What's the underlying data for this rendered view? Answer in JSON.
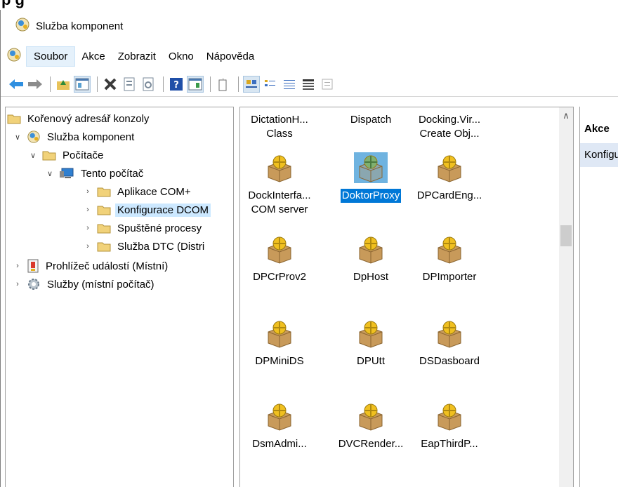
{
  "heading": "p         g",
  "window": {
    "title": "Služba komponent"
  },
  "menu": [
    "Soubor",
    "Akce",
    "Zobrazit",
    "Okno",
    "Nápověda"
  ],
  "tree": [
    {
      "label": "Kořenový adresář konzoly",
      "chevron": "",
      "icon": "folder"
    },
    {
      "label": "Služba komponent",
      "chevron": "down",
      "icon": "component"
    },
    {
      "label": "Počítače",
      "chevron": "down",
      "icon": "folder"
    },
    {
      "label": "Tento počítač",
      "chevron": "down",
      "icon": "computer"
    },
    {
      "label": "Aplikace COM+",
      "chevron": "right",
      "icon": "folder"
    },
    {
      "label": "Konfigurace DCOM",
      "chevron": "right",
      "icon": "folder",
      "selected": true
    },
    {
      "label": "Spuštěné procesy",
      "chevron": "right",
      "icon": "folder"
    },
    {
      "label": "Služba DTC (Distri",
      "chevron": "right",
      "icon": "folder"
    },
    {
      "label": "Prohlížeč událostí (Místní)",
      "chevron": "right",
      "icon": "event"
    },
    {
      "label": "Služby (místní počítač)",
      "chevron": "right",
      "icon": "gear"
    }
  ],
  "list": {
    "row0": [
      {
        "line1": "DictationH...",
        "line2": "Class"
      },
      {
        "line1": "Dispatch",
        "line2": ""
      },
      {
        "line1": "Docking.Vir...",
        "line2": "Create Obj..."
      }
    ],
    "items": [
      {
        "line1": "DockInterfa...",
        "line2": "COM server"
      },
      {
        "line1": "DoktorProxy",
        "line2": "",
        "selected": true
      },
      {
        "line1": "DPCardEng...",
        "line2": ""
      },
      {
        "line1": "DPCrProv2",
        "line2": ""
      },
      {
        "line1": "DpHost",
        "line2": ""
      },
      {
        "line1": "DPImporter",
        "line2": ""
      },
      {
        "line1": "DPMiniDS",
        "line2": ""
      },
      {
        "line1": "DPUtt",
        "line2": ""
      },
      {
        "line1": "DSDasboard",
        "line2": ""
      },
      {
        "line1": "DsmAdmi...",
        "line2": ""
      },
      {
        "line1": "DVCRender...",
        "line2": ""
      },
      {
        "line1": "EapThirdP...",
        "line2": ""
      }
    ]
  },
  "actions": {
    "header": "Akce",
    "item": "Konfigurace DCOM"
  },
  "colors": {
    "selection": "#0078d7",
    "treeSelection": "#cce8ff"
  }
}
